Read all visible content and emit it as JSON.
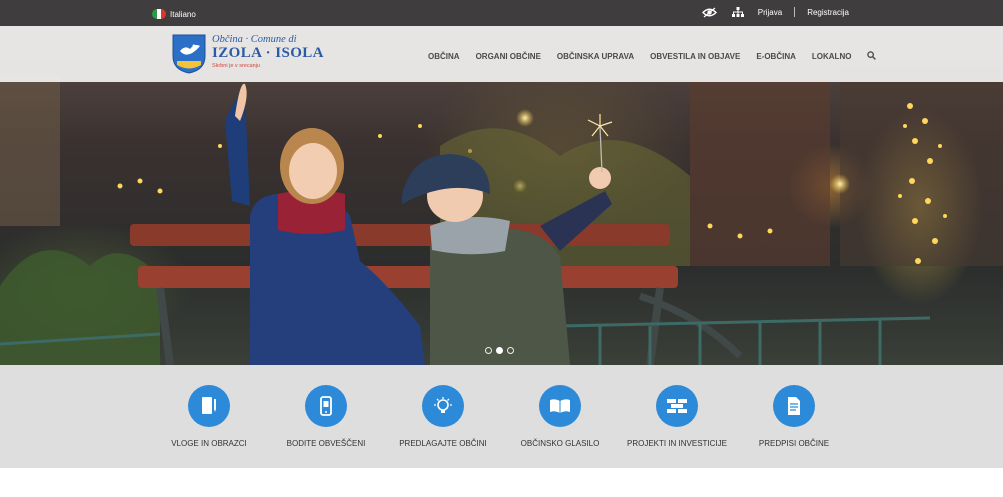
{
  "topbar": {
    "language": "Italiano",
    "login": "Prijava",
    "register": "Registracija",
    "icons": [
      "accessibility-eye-icon",
      "sitemap-icon"
    ]
  },
  "logo": {
    "line1": "Občina · Comune di",
    "line2": "IZOLA · ISOLA",
    "tagline": "Skrbni je v srecanju"
  },
  "menu": {
    "items": [
      "OBČINA",
      "ORGANI OBČINE",
      "OBČINSKA UPRAVA",
      "OBVESTILA IN OBJAVE",
      "E-OBČINA",
      "LOKALNO"
    ],
    "search_icon": "search-icon"
  },
  "slider": {
    "slide_count": 3,
    "active_slide": 2
  },
  "services": [
    {
      "label": "VLOGE IN OBRAZCI",
      "icon": "forms-icon"
    },
    {
      "label": "BODITE OBVEŠČENI",
      "icon": "phone-notification-icon"
    },
    {
      "label": "PREDLAGAJTE OBČINI",
      "icon": "lightbulb-icon"
    },
    {
      "label": "OBČINSKO GLASILO",
      "icon": "open-book-icon"
    },
    {
      "label": "PROJEKTI IN INVESTICIJE",
      "icon": "bricks-icon"
    },
    {
      "label": "PREDPISI OBČINE",
      "icon": "document-icon"
    }
  ],
  "colors": {
    "topbar": "#3f3d3e",
    "accent_blue": "#2d8ad8",
    "services_bg": "#dedede",
    "logo_blue": "#2b5aa3",
    "tagline_red": "#d2453a"
  }
}
